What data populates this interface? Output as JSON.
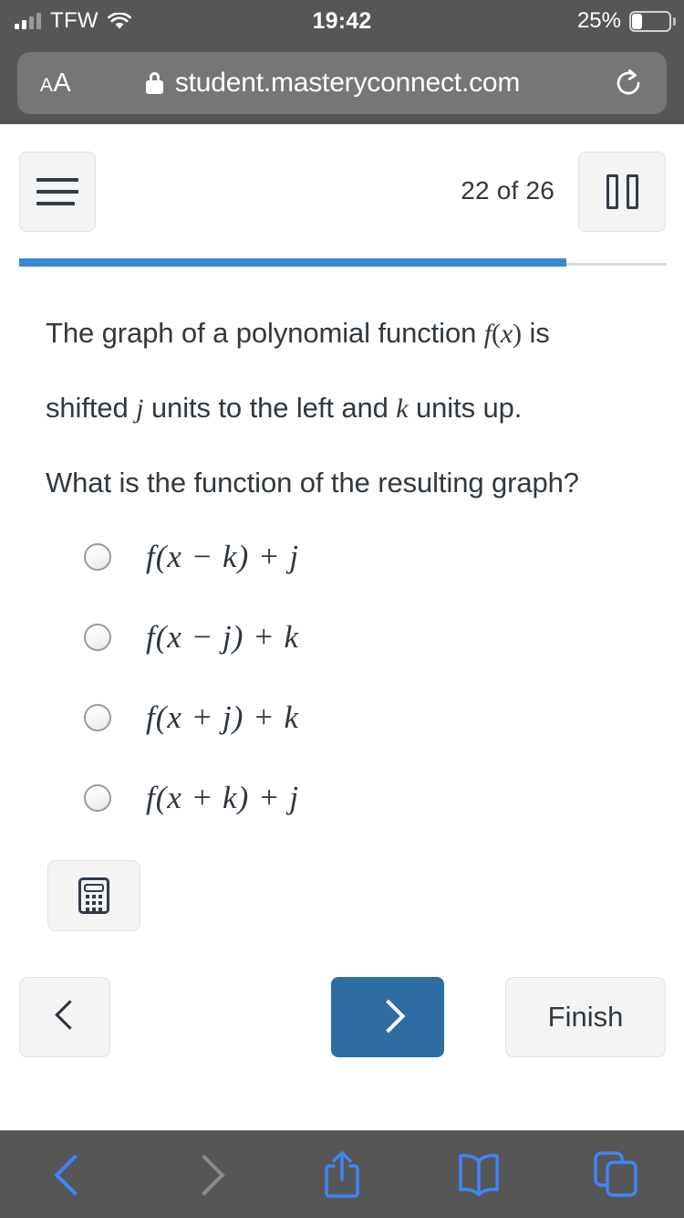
{
  "status_bar": {
    "carrier": "TFW",
    "time": "19:42",
    "battery_percent": "25%",
    "signal_icon": "cellular-signal-icon",
    "wifi_icon": "wifi-icon",
    "battery_icon": "battery-icon"
  },
  "browser": {
    "text_size_small": "A",
    "text_size_large": "A",
    "lock_icon": "lock-icon",
    "url": "student.masteryconnect.com",
    "reload_icon": "reload-icon",
    "bottom": {
      "back_icon": "chevron-left-icon",
      "forward_icon": "chevron-right-icon",
      "share_icon": "share-icon",
      "bookmarks_icon": "book-icon",
      "tabs_icon": "tabs-icon"
    }
  },
  "assessment": {
    "menu_icon": "hamburger-menu-icon",
    "counter": "22 of 26",
    "pause_icon": "pause-icon",
    "progress_percent": 84.5,
    "progress_color": "#3b88d4",
    "question": {
      "line1_a": "The graph of a polynomial function ",
      "line1_math": "f(x)",
      "line1_b": " is",
      "line2_a": "shifted ",
      "line2_math1": "j",
      "line2_b": " units to the left and ",
      "line2_math2": "k",
      "line2_c": " units up.",
      "line3": "What is the function of the resulting graph?"
    },
    "options": [
      {
        "id": "A",
        "label": "f(x − k) + j",
        "selected": false
      },
      {
        "id": "B",
        "label": "f(x − j) + k",
        "selected": false
      },
      {
        "id": "C",
        "label": "f(x + j) + k",
        "selected": false
      },
      {
        "id": "D",
        "label": "f(x + k) + j",
        "selected": false
      }
    ],
    "calculator_icon": "calculator-icon",
    "prev_icon": "chevron-left-icon",
    "next_icon": "chevron-right-icon",
    "next_button_color": "#2e6da4",
    "finish_label": "Finish"
  }
}
